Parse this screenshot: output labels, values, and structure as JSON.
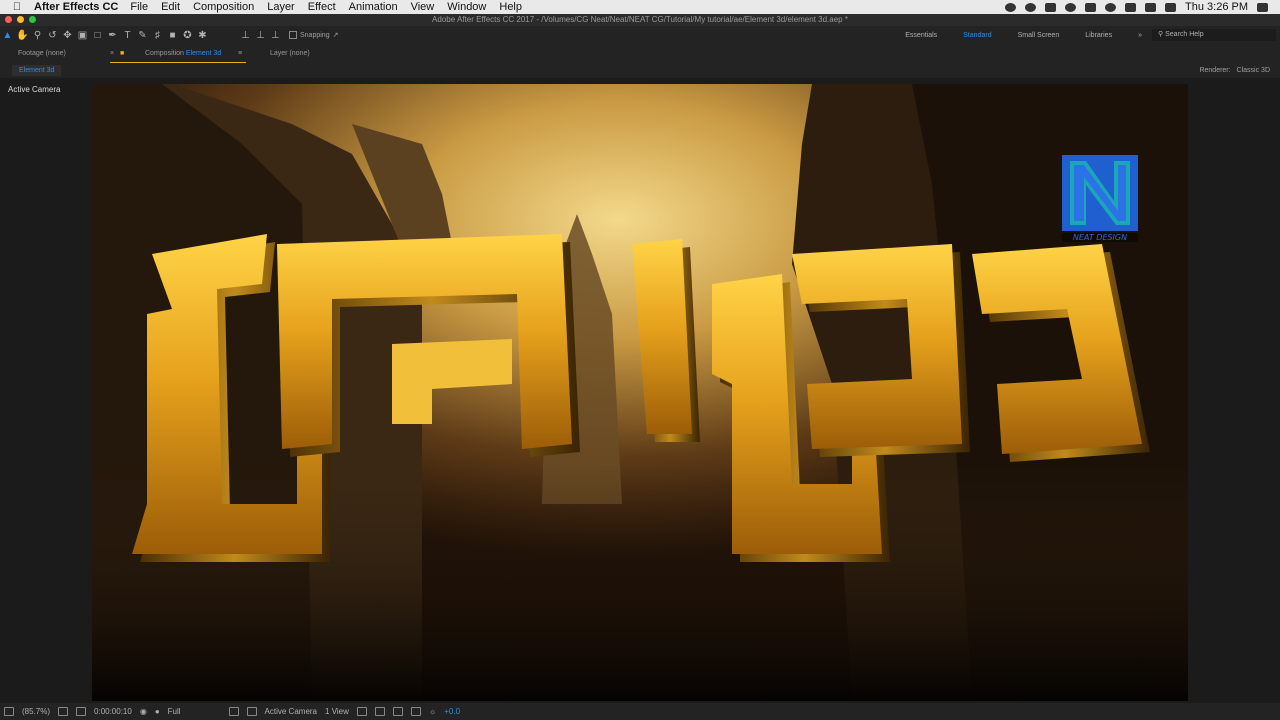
{
  "menubar": {
    "app_name": "After Effects CC",
    "items": [
      "File",
      "Edit",
      "Composition",
      "Layer",
      "Effect",
      "Animation",
      "View",
      "Window",
      "Help"
    ],
    "clock": "Thu 3:26 PM"
  },
  "window": {
    "title": "Adobe After Effects CC 2017 - /Volumes/CG Neat/Neat/NEAT CG/Tutorial/My tutorial/ae/Element 3d/element 3d.aep *"
  },
  "toolbar": {
    "snapping_label": "Snapping",
    "workspaces": [
      "Essentials",
      "Standard",
      "Small Screen",
      "Libraries"
    ],
    "active_workspace": "Standard",
    "search_placeholder": "Search Help"
  },
  "panels": {
    "footage_tab": "Footage (none)",
    "composition_prefix": "Composition",
    "composition_name": "Element 3d",
    "layer_tab": "Layer (none)",
    "comp_subtab": "Element 3d",
    "renderer_label": "Renderer:",
    "renderer_value": "Classic 3D"
  },
  "viewer": {
    "camera_label": "Active Camera",
    "logo_text": "NEAT DESIGN",
    "logo_letter": "N"
  },
  "bottombar": {
    "zoom": "(85.7%)",
    "timecode": "0:00:00:10",
    "resolution": "Full",
    "camera": "Active Camera",
    "views": "1 View",
    "exposure": "+0.0"
  },
  "colors": {
    "accent": "#2d8ceb",
    "tab_underline": "#e8b01a",
    "gold": "#e6a21c"
  }
}
